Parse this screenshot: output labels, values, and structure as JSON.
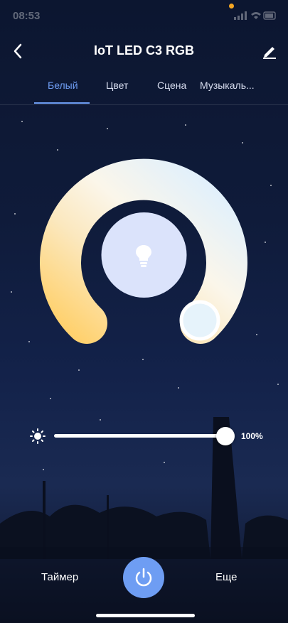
{
  "status": {
    "time": "08:53"
  },
  "header": {
    "title": "IoT LED C3 RGB"
  },
  "tabs": [
    {
      "label": "Белый",
      "active": true
    },
    {
      "label": "Цвет"
    },
    {
      "label": "Сцена"
    },
    {
      "label": "Музыкаль..."
    }
  ],
  "brightness": {
    "value_label": "100%",
    "value": 1.0
  },
  "bottom": {
    "timer_label": "Таймер",
    "more_label": "Еще"
  },
  "colors": {
    "accent": "#6e9df3",
    "warm": "#ffd57a",
    "cool": "#e6f3fb",
    "center": "#dbe3fb"
  },
  "icons": [
    "back-arrow-icon",
    "edit-pencil-icon",
    "bulb-icon",
    "sun-icon",
    "power-icon"
  ]
}
